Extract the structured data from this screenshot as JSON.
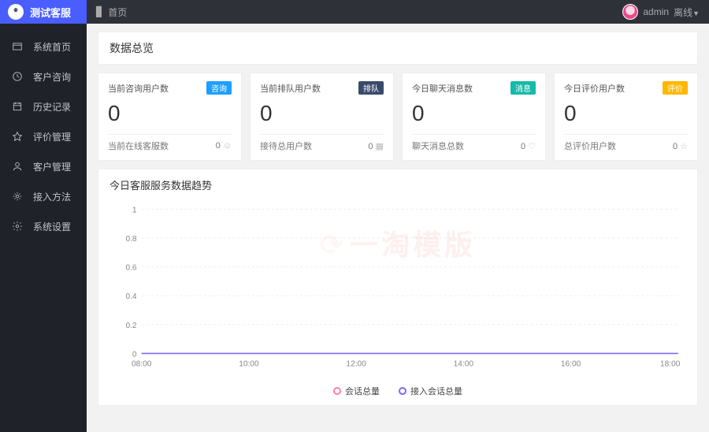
{
  "brand": {
    "title": "测试客服"
  },
  "topbar": {
    "home_label": "首页",
    "user_name": "admin",
    "status_label": "离线"
  },
  "nav": {
    "items": [
      {
        "id": "home",
        "label": "系统首页"
      },
      {
        "id": "consult",
        "label": "客户咨询"
      },
      {
        "id": "history",
        "label": "历史记录"
      },
      {
        "id": "rating",
        "label": "评价管理"
      },
      {
        "id": "customer",
        "label": "客户管理"
      },
      {
        "id": "method",
        "label": "接入方法"
      },
      {
        "id": "settings",
        "label": "系统设置"
      }
    ]
  },
  "overview": {
    "title": "数据总览",
    "cards": [
      {
        "label": "当前咨询用户数",
        "badge": "咨询",
        "badge_class": "badge-blue",
        "value": "0",
        "sub_label": "当前在线客服数",
        "sub_value": "0"
      },
      {
        "label": "当前排队用户数",
        "badge": "排队",
        "badge_class": "badge-navy",
        "value": "0",
        "sub_label": "接待总用户数",
        "sub_value": "0"
      },
      {
        "label": "今日聊天消息数",
        "badge": "消息",
        "badge_class": "badge-teal",
        "value": "0",
        "sub_label": "聊天消息总数",
        "sub_value": "0"
      },
      {
        "label": "今日评价用户数",
        "badge": "评价",
        "badge_class": "badge-orange",
        "value": "0",
        "sub_label": "总评价用户数",
        "sub_value": "0"
      }
    ]
  },
  "chart": {
    "title": "今日客服服务数据趋势",
    "legend": [
      {
        "label": "会话总量",
        "class": "dot-pink"
      },
      {
        "label": "接入会话总量",
        "class": "dot-purple"
      }
    ],
    "watermark": "一淘模版"
  },
  "chart_data": {
    "type": "line",
    "x": [
      "08:00",
      "10:00",
      "12:00",
      "14:00",
      "16:00",
      "18:00"
    ],
    "series": [
      {
        "name": "会话总量",
        "values": [
          0,
          0,
          0,
          0,
          0,
          0
        ]
      },
      {
        "name": "接入会话总量",
        "values": [
          0,
          0,
          0,
          0,
          0,
          0
        ]
      }
    ],
    "ylim": [
      0,
      1
    ],
    "yticks": [
      0,
      0.2,
      0.4,
      0.6,
      0.8,
      1
    ],
    "xlabel": "",
    "ylabel": ""
  }
}
